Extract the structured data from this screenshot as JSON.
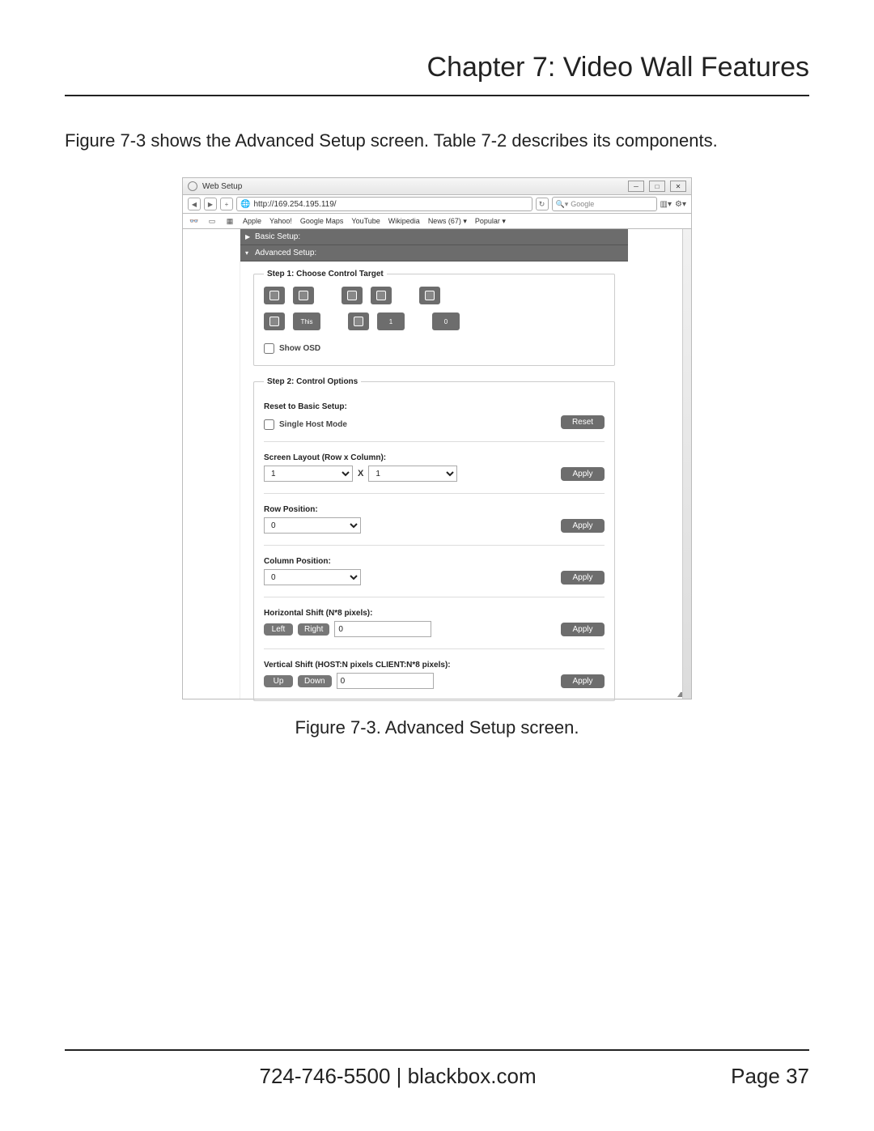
{
  "doc": {
    "chapter_title": "Chapter 7: Video Wall Features",
    "intro": "Figure 7-3 shows the Advanced Setup screen. Table 7-2 describes its components.",
    "caption": "Figure 7-3. Advanced Setup screen.",
    "footer_phone": "724-746-5500",
    "footer_site": "blackbox.com",
    "footer_sep": "   |   ",
    "page_label": "Page 37"
  },
  "shot": {
    "window_title": "Web Setup",
    "url": "http://169.254.195.119/",
    "search_placeholder": "Google",
    "bookmarks": [
      "Apple",
      "Yahoo!",
      "Google Maps",
      "YouTube",
      "Wikipedia",
      "News (67) ▾",
      "Popular ▾"
    ],
    "accordion": {
      "basic": "Basic Setup:",
      "advanced": "Advanced Setup:"
    },
    "step1": {
      "legend": "Step 1: Choose Control Target",
      "this_label": "This",
      "num_label": "1",
      "zero_label": "0",
      "show_osd": "Show OSD"
    },
    "step2": {
      "legend": "Step 2: Control Options",
      "reset_label": "Reset to Basic Setup:",
      "single_host": "Single Host Mode",
      "reset_btn": "Reset",
      "screen_layout_label": "Screen Layout (Row x Column):",
      "rows_value": "1",
      "cols_value": "1",
      "x": "X",
      "apply": "Apply",
      "row_pos_label": "Row Position:",
      "row_pos_value": "0",
      "col_pos_label": "Column Position:",
      "col_pos_value": "0",
      "hshift_label": "Horizontal Shift (N*8 pixels):",
      "left": "Left",
      "right": "Right",
      "hshift_value": "0",
      "vshift_label": "Vertical Shift (HOST:N pixels CLIENT:N*8 pixels):",
      "up": "Up",
      "down": "Down",
      "vshift_value": "0"
    }
  }
}
